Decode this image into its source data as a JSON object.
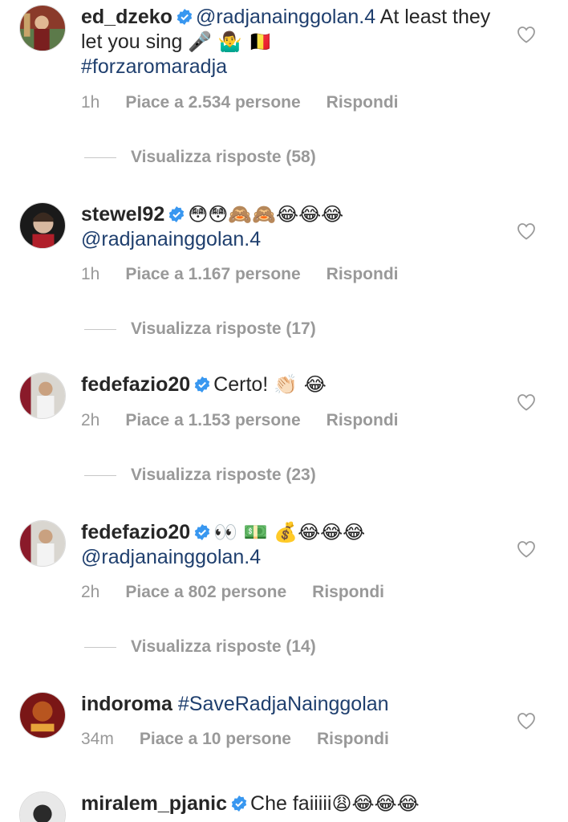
{
  "colors": {
    "text": "#262626",
    "meta": "#999999",
    "link": "#1f3f6e",
    "verified": "#3897f0"
  },
  "comments": [
    {
      "username": "ed_dzeko",
      "mention": "@radjanainggolan.4",
      "text": " At least they let you sing",
      "emojis": "🎤 🤷‍♂️ 🇧🇪",
      "hashtag": "#forzaromaradja",
      "time": "1h",
      "likes": "Piace a 2.534 persone",
      "reply": "Rispondi",
      "view_replies": "Visualizza risposte (58)"
    },
    {
      "username": "stewel92",
      "emojis": "😳😳🙈🙈😂😂😂",
      "mention": "@radjanainggolan.4",
      "time": "1h",
      "likes": "Piace a 1.167 persone",
      "reply": "Rispondi",
      "view_replies": "Visualizza risposte (17)"
    },
    {
      "username": "fedefazio20",
      "text": "Certo!",
      "emojis": "👏🏻 😂",
      "time": "2h",
      "likes": "Piace a 1.153 persone",
      "reply": "Rispondi",
      "view_replies": "Visualizza risposte (23)"
    },
    {
      "username": "fedefazio20",
      "emojis": "👀 💵 💰😂😂😂",
      "mention": "@radjanainggolan.4",
      "time": "2h",
      "likes": "Piace a 802 persone",
      "reply": "Rispondi",
      "view_replies": "Visualizza risposte (14)"
    },
    {
      "username": "indoroma",
      "hashtag": "#SaveRadjaNainggolan",
      "time": "34m",
      "likes": "Piace a 10 persone",
      "reply": "Rispondi"
    },
    {
      "username": "miralem_pjanic",
      "text": "Che faiiiii",
      "emojis": "😩😂😂😂"
    }
  ],
  "icons": {
    "verified": "verified-badge-icon",
    "like": "heart-icon"
  }
}
